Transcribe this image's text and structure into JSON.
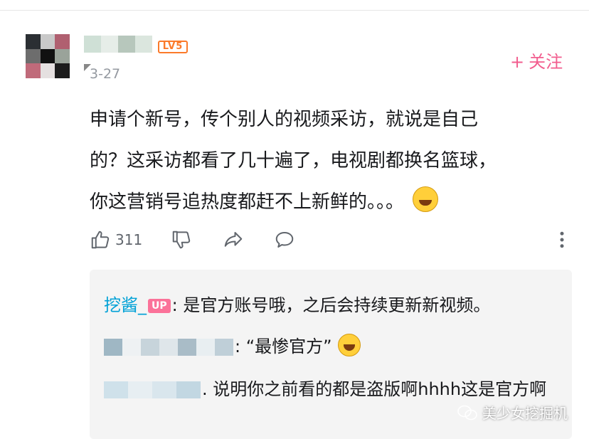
{
  "user": {
    "level_badge": "LV5",
    "date": "3-27",
    "avatar_pixels": [
      "#2b2f33",
      "#c9c9c9",
      "#b06070",
      "#6d6d6d",
      "#111111",
      "#9aa39a",
      "#c06a7a",
      "#e5e0e0",
      "#1c1c1c"
    ],
    "name_blur_pixels": [
      "#cfe0d6",
      "#e6ede8",
      "#b7c7bc",
      "#dbe6de"
    ]
  },
  "follow": {
    "label": "关注",
    "plus": "+",
    "color": "#f25d8e"
  },
  "comment": {
    "line1": "申请个新号，传个别人的视频采访，就说是自己",
    "line2": "的？这采访都看了几十遍了，电视剧都换名篮球，",
    "line3": "你这营销号追热度都赶不上新鲜的。。。"
  },
  "actions": {
    "like_count": "311"
  },
  "replies": [
    {
      "username": "挖酱_",
      "badge": "UP",
      "text": ": 是官方账号哦，之后会持续更新新视频。"
    },
    {
      "text": ": “最惨官方”",
      "blur": [
        "#9fb7c4",
        "#eef1f3",
        "#c7d4db",
        "#dfe6ea",
        "#a9bcc7",
        "#e8eef1",
        "#bfcfd8"
      ]
    },
    {
      "text": ". 说明你之前看的都是盗版啊hhhh这是官方啊",
      "blur": [
        "#cfe1ea",
        "#e7eef2",
        "#d9e6ed",
        "#c2d7e2"
      ]
    }
  ],
  "watermark": {
    "text": "美少女挖掘机"
  }
}
